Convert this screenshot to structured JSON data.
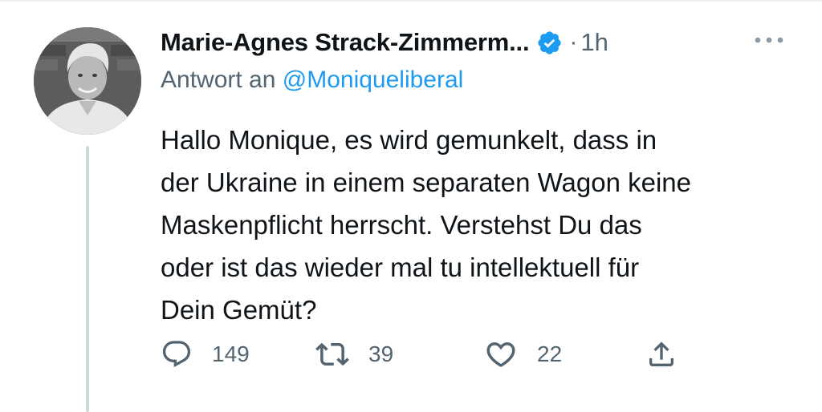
{
  "tweet": {
    "author_name": "Marie-Agnes Strack-Zimmerm...",
    "separator": "·",
    "time": "1h",
    "reply_prefix": "Antwort an ",
    "reply_handle": "@Moniqueliberal",
    "text": "Hallo Monique, es wird gemunkelt, dass in\nder Ukraine in einem separaten Wagon keine\nMaskenpflicht herrscht. Verstehst Du das\noder ist das wieder mal tu intellektuell für\nDein Gemüt?",
    "counts": {
      "replies": "149",
      "retweets": "39",
      "likes": "22"
    }
  },
  "icons": {
    "verified": "verified-badge-icon",
    "more": "more-dots-icon",
    "reply": "reply-bubble-icon",
    "retweet": "retweet-icon",
    "like": "heart-icon",
    "share": "share-icon"
  },
  "colors": {
    "text": "#0f1419",
    "secondary": "#536471",
    "link": "#1d9bf0",
    "verified": "#1d9bf0",
    "thread_line": "#cfd9de"
  }
}
